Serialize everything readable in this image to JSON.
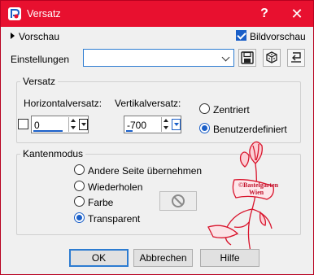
{
  "window": {
    "title": "Versatz",
    "help_glyph": "?",
    "close_glyph": "✕",
    "accent_color": "#e8102f"
  },
  "preview": {
    "toggle_label": "Vorschau",
    "live_preview_label": "Bildvorschau",
    "live_preview_checked": true
  },
  "settings": {
    "label": "Einstellungen",
    "combo_value": "",
    "icons": [
      "save-preset-icon",
      "random-cube-icon",
      "reset-icon"
    ]
  },
  "offset": {
    "group_title": "Versatz",
    "horizontal_label": "Horizontalversatz:",
    "horizontal_value": "0",
    "vertical_label": "Vertikalversatz:",
    "vertical_value": "-700",
    "link_checked": false,
    "centered_label": "Zentriert",
    "custom_label": "Benutzerdefiniert",
    "selected": "custom"
  },
  "edge_mode": {
    "group_title": "Kantenmodus",
    "options": [
      "Andere Seite übernehmen",
      "Wiederholen",
      "Farbe",
      "Transparent"
    ],
    "selected": "Transparent"
  },
  "watermark": {
    "line1": "©Bastelgarten",
    "line2": "Wien"
  },
  "buttons": {
    "ok": "OK",
    "cancel": "Abbrechen",
    "help": "Hilfe"
  }
}
